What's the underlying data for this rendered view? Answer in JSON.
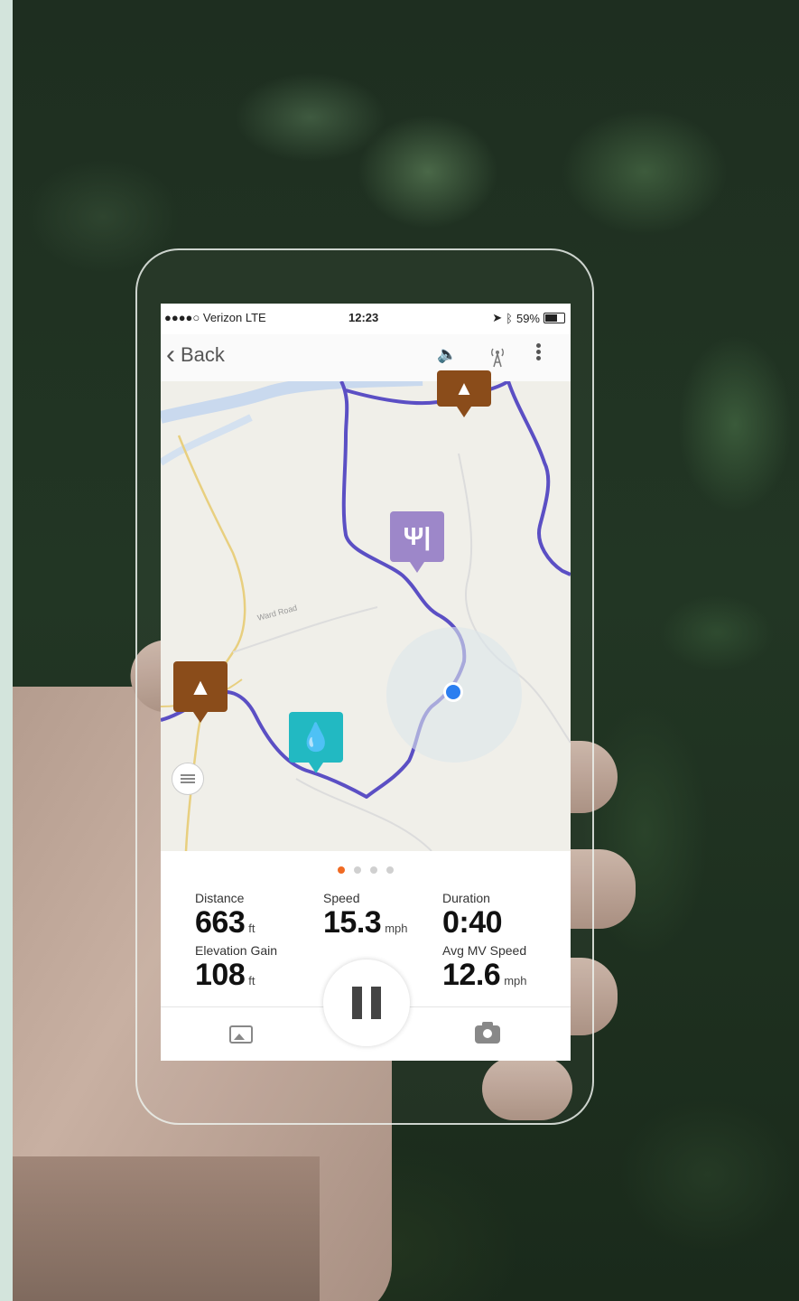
{
  "status_bar": {
    "carrier": "●●●●○ Verizon  LTE",
    "time": "12:23",
    "battery": "59%"
  },
  "nav": {
    "back_label": "Back",
    "icons": [
      "volume-icon",
      "signal-icon",
      "more-icon"
    ]
  },
  "map": {
    "pois": [
      {
        "type": "campsite",
        "icon": "tent-icon",
        "color": "#8a4c1a"
      },
      {
        "type": "food",
        "icon": "fork-knife-icon",
        "color": "#9d87c9"
      },
      {
        "type": "campsite",
        "icon": "tent-icon",
        "color": "#8a4c1a"
      },
      {
        "type": "water",
        "icon": "water-drop-icon",
        "color": "#22b9c2"
      }
    ],
    "route_color": "#5b4fc4",
    "location_color": "#2b7ef0",
    "road_label": "Ward Road"
  },
  "stats": {
    "page_indicator": {
      "total": 4,
      "active": 0
    },
    "distance": {
      "label": "Distance",
      "value": "663",
      "unit": "ft"
    },
    "speed": {
      "label": "Speed",
      "value": "15.3",
      "unit": "mph"
    },
    "duration": {
      "label": "Duration",
      "value": "0:40"
    },
    "elevation": {
      "label": "Elevation Gain",
      "value": "108",
      "unit": "ft"
    },
    "avg_speed": {
      "label": "Avg MV Speed",
      "value": "12.6",
      "unit": "mph"
    }
  },
  "colors": {
    "accent": "#f06a23"
  }
}
